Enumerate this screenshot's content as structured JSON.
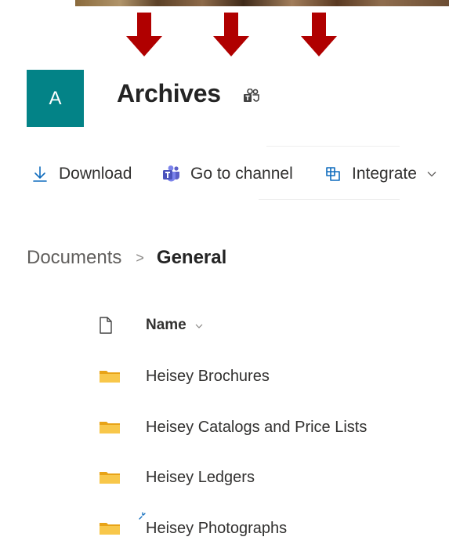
{
  "banner": {
    "arrows": [
      "arrow-down-icon",
      "arrow-down-icon",
      "arrow-down-icon"
    ],
    "arrow_color": "#B00000"
  },
  "site": {
    "logo_letter": "A",
    "logo_color": "#038387",
    "title": "Archives",
    "teams_icon": "teams-icon"
  },
  "command_bar": {
    "download_label": "Download",
    "go_to_channel_label": "Go to channel",
    "integrate_label": "Integrate"
  },
  "breadcrumb": {
    "root": "Documents",
    "separator": ">",
    "current": "General"
  },
  "file_list": {
    "column_name": "Name",
    "items": [
      {
        "label": "Heisey Brochures",
        "icon": "folder-icon"
      },
      {
        "label": "Heisey Catalogs and Price Lists",
        "icon": "folder-icon"
      },
      {
        "label": "Heisey Ledgers",
        "icon": "folder-icon"
      },
      {
        "label": "Heisey Photographs",
        "icon": "folder-icon"
      }
    ]
  },
  "colors": {
    "folder": "#F4C23A",
    "text": "#242424",
    "teams_purple": "#5B5FC7",
    "accent_teal": "#038387"
  }
}
